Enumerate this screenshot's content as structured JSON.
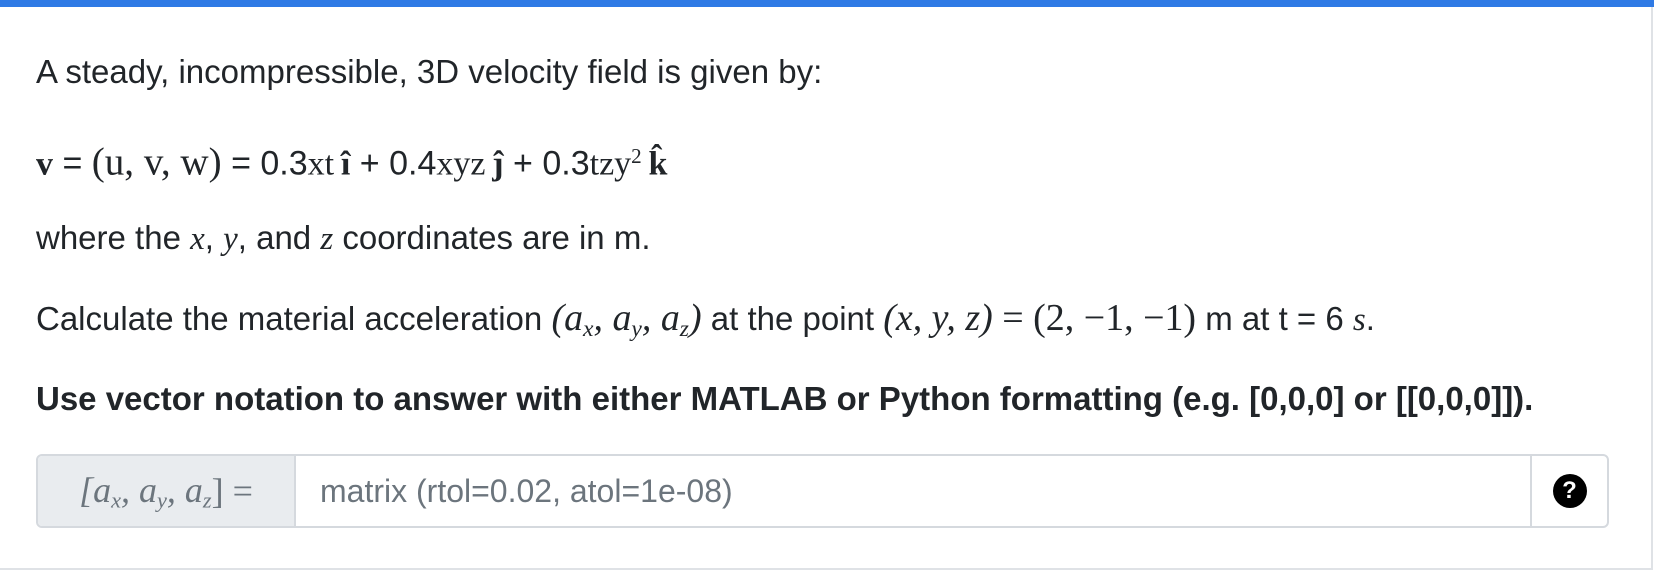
{
  "question": {
    "intro": "A steady, incompressible, 3D velocity field is given by:",
    "equation": {
      "lhs_vec": "v",
      "eq1": " = ",
      "tuple": "(u, v, w)",
      "eq2": " = ",
      "term1_coef": "0.3",
      "term1_vars": "xt",
      "unit_i": "î",
      "plus1": " + ",
      "term2_coef": "0.4",
      "term2_vars": "xyz",
      "unit_j": "ĵ",
      "plus2": " + ",
      "term3_coef": "0.3",
      "term3_vars": "tzy",
      "term3_exp": "2",
      "unit_k": "k̂"
    },
    "coords_text": {
      "pre": "where the ",
      "x": "x",
      "comma1": ", ",
      "y": "y",
      "and": ", and ",
      "z": "z",
      "post": " coordinates are in m."
    },
    "task": {
      "pre": "Calculate the material acceleration ",
      "accel": "(a",
      "sx": "x",
      "c1": ", a",
      "sy": "y",
      "c2": ", a",
      "sz": "z",
      "close": ")",
      "mid": " at the point ",
      "point_vars": "(x, y, z)",
      "point_eq": " = (2, −1, −1)",
      "units": " m at t = 6 ",
      "time_unit": "s",
      "period": "."
    },
    "instruction": "Use vector notation to answer with either MATLAB or Python formatting (e.g. [0,0,0] or [[0,0,0]])."
  },
  "answer": {
    "prefix_open": "[a",
    "prefix_sx": "x",
    "prefix_c1": ", a",
    "prefix_sy": "y",
    "prefix_c2": ", a",
    "prefix_sz": "z",
    "prefix_close": "] =",
    "placeholder": "matrix (rtol=0.02, atol=1e-08)",
    "value": "",
    "help_icon": "question-circle-icon",
    "help_symbol": "?"
  },
  "colors": {
    "accent": "#2f7ae5",
    "addon_bg": "#e9ecef",
    "border": "#d5d9de"
  }
}
